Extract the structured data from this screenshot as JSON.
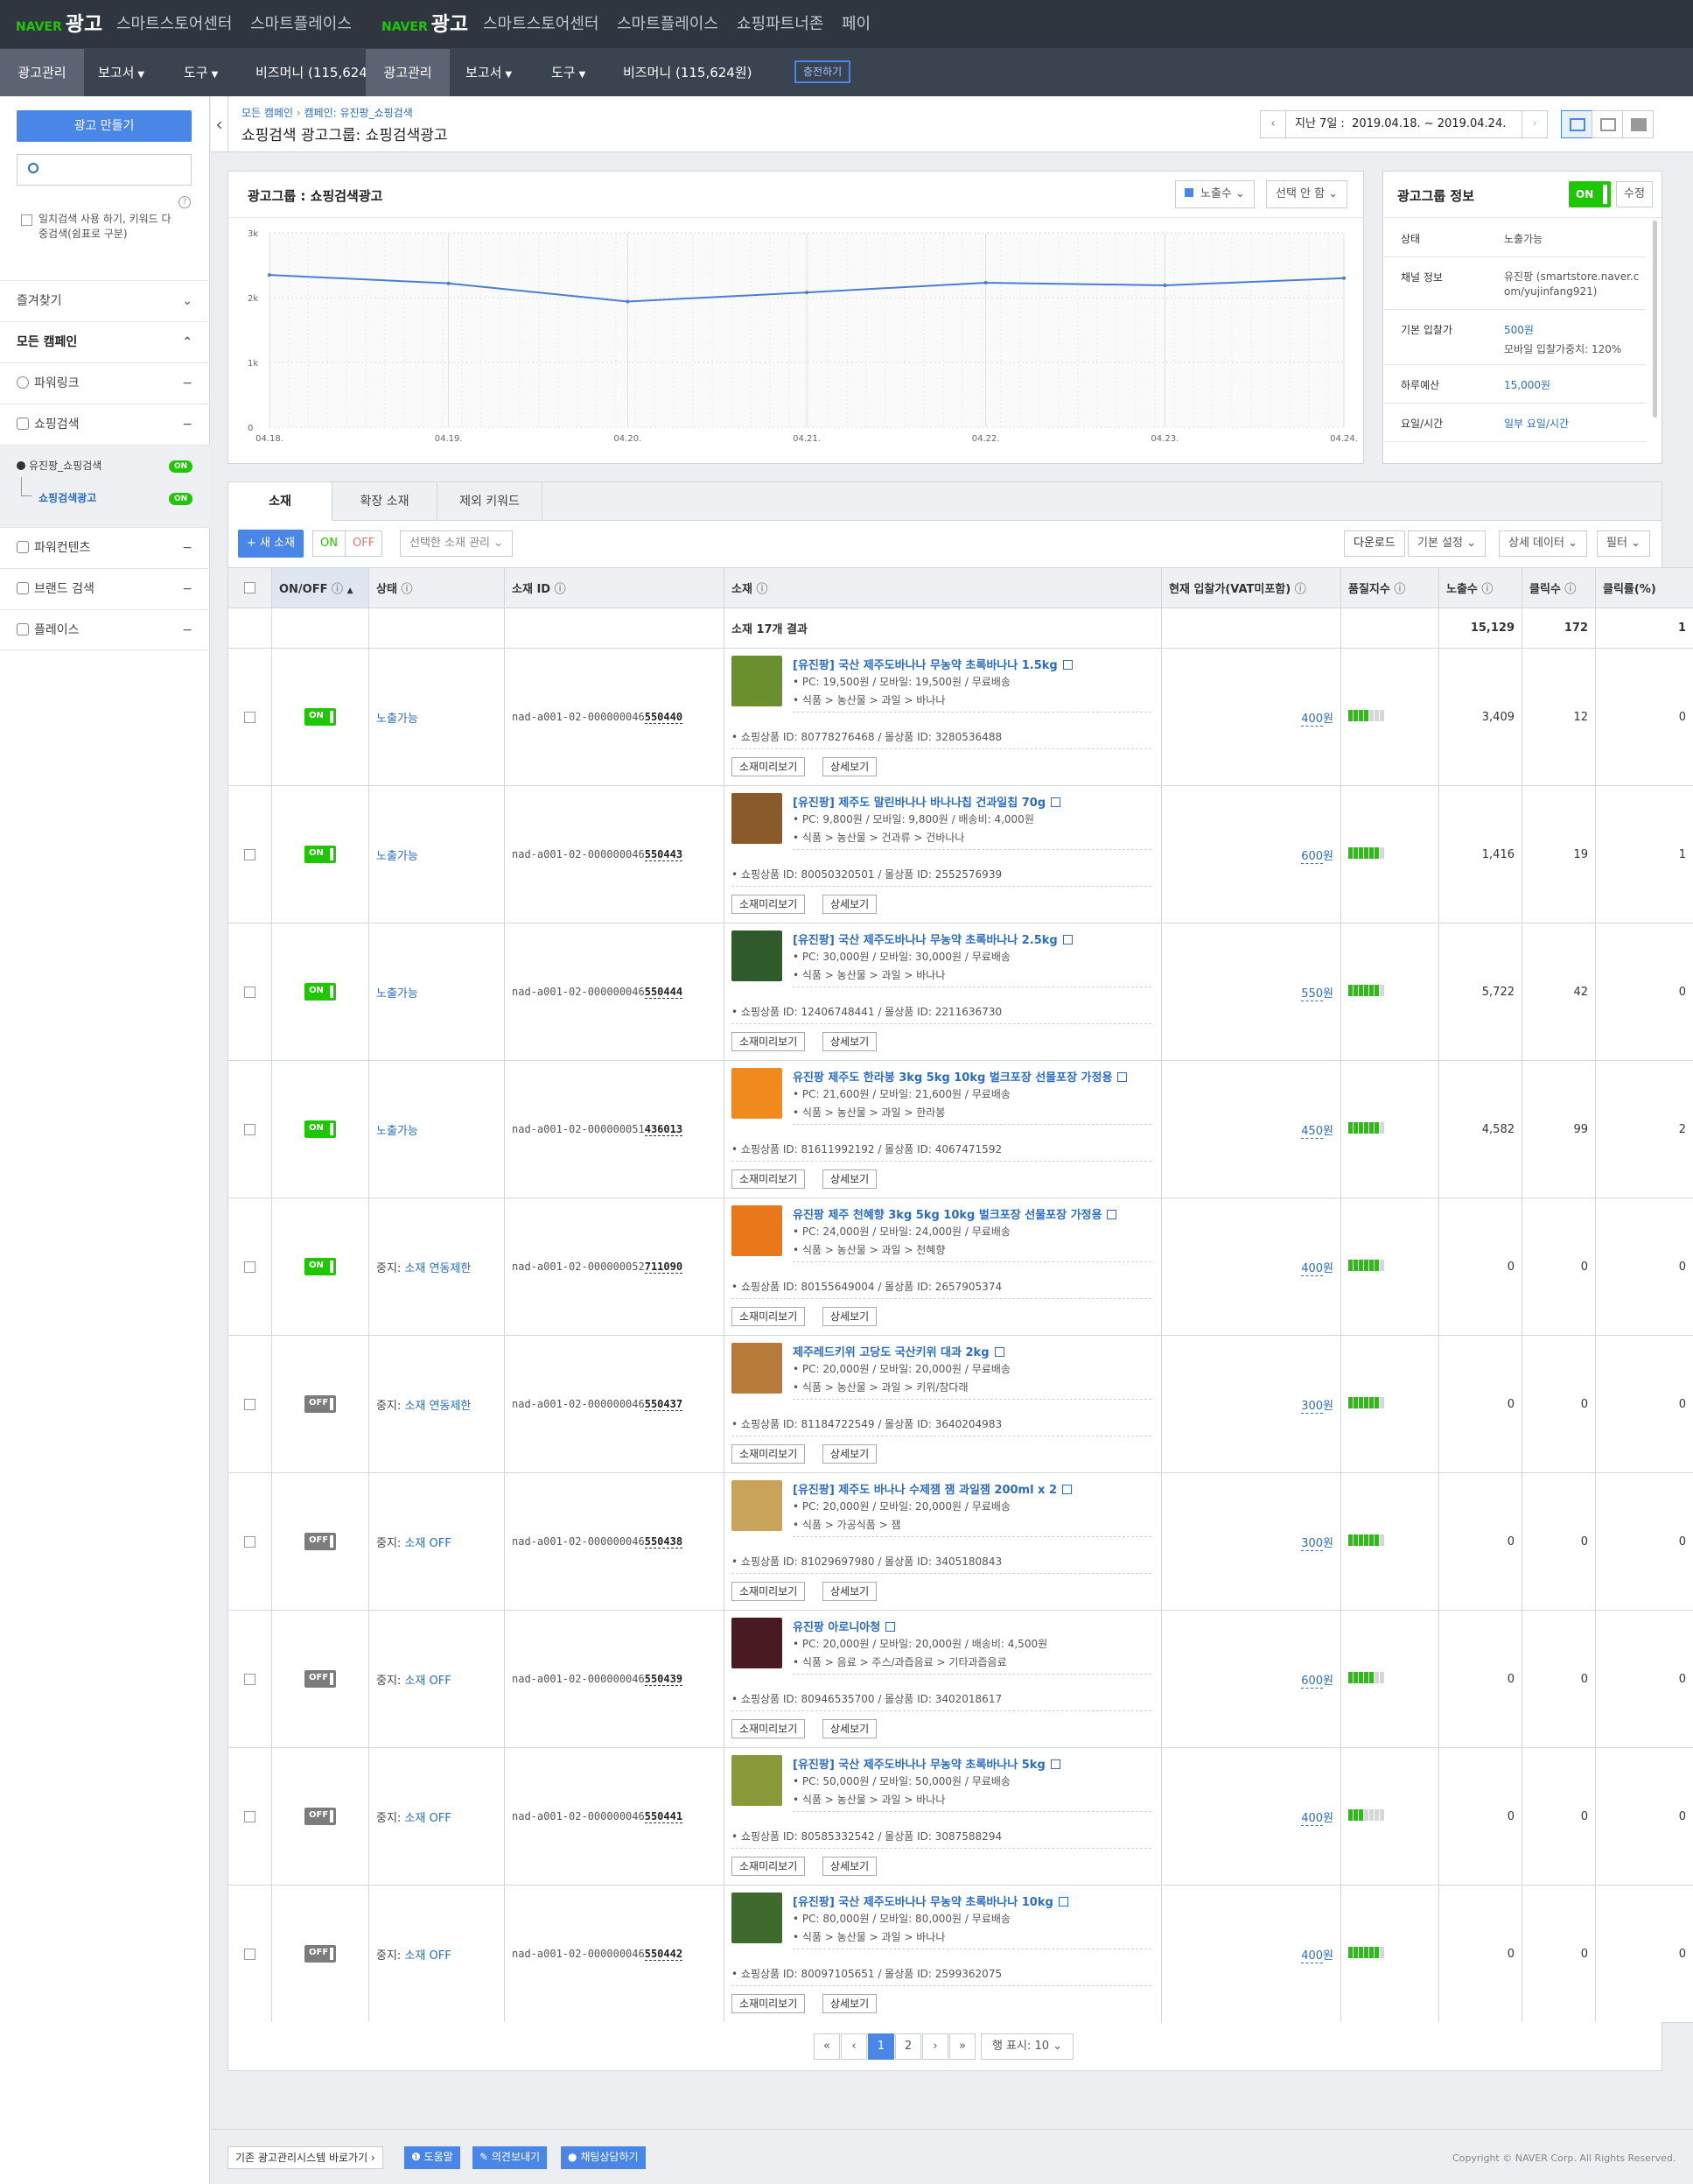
{
  "header": {
    "brand_left": "NAVER",
    "brand_right": "광고",
    "links1": [
      "스마트스토어센터",
      "스마트플레이스"
    ],
    "links2": [
      "스마트스토어센터",
      "스마트플레이스",
      "쇼핑파트너존",
      "페이"
    ]
  },
  "nav": {
    "items1": [
      "광고관리",
      "보고서",
      "도구",
      "비즈머니 (115,624"
    ],
    "items2": [
      "광고관리",
      "보고서",
      "도구",
      "비즈머니 (115,624원)"
    ],
    "charge": "충전하기"
  },
  "sidebar": {
    "create_btn": "광고 만들기",
    "exact_match": "일치검색 사용 하기, 키워드 다중검색(쉼표로 구분)",
    "favorites": "즐겨찾기",
    "all_campaigns": "모든 캠페인",
    "items": [
      "파워링크",
      "쇼핑검색",
      "파워컨텐츠",
      "브랜드 검색",
      "플레이스"
    ],
    "campaign": "유진팡_쇼핑검색",
    "adgroup": "쇼핑검색광고",
    "on": "ON"
  },
  "breadcrumb": {
    "path1": "모든 캠페인",
    "sep": "›",
    "path2": "캠페인: 유진팡_쇼핑검색",
    "title": "쇼핑검색 광고그룹: 쇼핑검색광고",
    "date_label": "지난 7일 :",
    "date_range": "2019.04.18. ~ 2019.04.24."
  },
  "chart_panel": {
    "title": "광고그룹 : 쇼핑검색광고",
    "metric": "노출수",
    "select": "선택 안 함"
  },
  "chart_data": {
    "type": "line",
    "categories": [
      "04.18.",
      "04.19.",
      "04.20.",
      "04.21.",
      "04.22.",
      "04.23.",
      "04.24."
    ],
    "series": [
      {
        "name": "노출수",
        "values": [
          2350,
          2220,
          1940,
          2080,
          2230,
          2190,
          2300
        ]
      }
    ],
    "yticks": [
      "0",
      "1k",
      "2k",
      "3k"
    ],
    "ylim": [
      0,
      3000
    ]
  },
  "info_panel": {
    "title": "광고그룹 정보",
    "toggle": "ON",
    "edit": "수정",
    "rows": [
      {
        "label": "상태",
        "value": "노출가능"
      },
      {
        "label": "채널 정보",
        "value": "유진팡 (smartstore.naver.com/yujinfang921)"
      },
      {
        "label": "기본 입찰가",
        "value": "500원",
        "extra": "모바일 입찰가중치: 120%"
      },
      {
        "label": "하루예산",
        "value": "15,000원"
      },
      {
        "label": "요일/시간",
        "value": "일부 요일/시간"
      }
    ]
  },
  "tabs": [
    "소재",
    "확장 소재",
    "제외 키워드"
  ],
  "toolbar": {
    "new": "+ 새 소재",
    "on": "ON",
    "off": "OFF",
    "manage": "선택한 소재 관리",
    "download": "다운로드",
    "basic": "기본 설정",
    "detail": "상세 데이터",
    "filter": "필터"
  },
  "table": {
    "headers": [
      "ON/OFF",
      "상태",
      "소재 ID",
      "소재",
      "현재 입찰가(VAT미포함)",
      "품질지수",
      "노출수",
      "클릭수",
      "클릭률(%)"
    ],
    "summary_label": "소재 17개 결과",
    "summary": {
      "impr": "15,129",
      "clicks": "172",
      "ctr": "1"
    },
    "btn_preview": "소재미리보기",
    "btn_detail": "상세보기",
    "rows": [
      {
        "toggle": "ON",
        "status": "노출가능",
        "status_pre": "",
        "id": "nad-a001-02-000000046",
        "id_tail": "550440",
        "title": "[유진팡] 국산 제주도바나나 무농약 초록바나나 1.5kg",
        "price": "PC: 19,500원 / 모바일: 19,500원 / 무료배송",
        "cat": "식품 > 농산물 > 과일 > 바나나",
        "ids": "쇼핑상품 ID: 80778276468 / 몰상품 ID: 3280536488",
        "bid": "400",
        "bidu": "원",
        "q": 4,
        "impr": "3,409",
        "clicks": "12",
        "ctr": "0",
        "img": "#6a8f2e"
      },
      {
        "toggle": "ON",
        "status": "노출가능",
        "status_pre": "",
        "id": "nad-a001-02-000000046",
        "id_tail": "550443",
        "title": "[유진팡] 제주도 말린바나나 바나나칩 건과일칩 70g",
        "price": "PC: 9,800원 / 모바일: 9,800원 / 배송비: 4,000원",
        "cat": "식품 > 농산물 > 건과류 > 건바나나",
        "ids": "쇼핑상품 ID: 80050320501 / 몰상품 ID: 2552576939",
        "bid": "600",
        "bidu": "원",
        "q": 6,
        "impr": "1,416",
        "clicks": "19",
        "ctr": "1",
        "img": "#8b5a2b"
      },
      {
        "toggle": "ON",
        "status": "노출가능",
        "status_pre": "",
        "id": "nad-a001-02-000000046",
        "id_tail": "550444",
        "title": "[유진팡] 국산 제주도바나나 무농약 초록바나나 2.5kg",
        "price": "PC: 30,000원 / 모바일: 30,000원 / 무료배송",
        "cat": "식품 > 농산물 > 과일 > 바나나",
        "ids": "쇼핑상품 ID: 12406748441 / 몰상품 ID: 2211636730",
        "bid": "550",
        "bidu": "원",
        "q": 6,
        "impr": "5,722",
        "clicks": "42",
        "ctr": "0",
        "img": "#2f5a2a"
      },
      {
        "toggle": "ON",
        "status": "노출가능",
        "status_pre": "",
        "id": "nad-a001-02-000000051",
        "id_tail": "436013",
        "title": "유진팡 제주도 한라봉 3kg 5kg 10kg 벌크포장 선물포장 가정용",
        "price": "PC: 21,600원 / 모바일: 21,600원 / 무료배송",
        "cat": "식품 > 농산물 > 과일 > 한라봉",
        "ids": "쇼핑상품 ID: 81611992192 / 몰상품 ID: 4067471592",
        "bid": "450",
        "bidu": "원",
        "q": 6,
        "impr": "4,582",
        "clicks": "99",
        "ctr": "2",
        "img": "#f08a1c"
      },
      {
        "toggle": "ON",
        "status": "소재 연동제한",
        "status_pre": "중지: ",
        "id": "nad-a001-02-000000052",
        "id_tail": "711090",
        "title": "유진팡 제주 천혜향 3kg 5kg 10kg 벌크포장 선물포장 가정용",
        "price": "PC: 24,000원 / 모바일: 24,000원 / 무료배송",
        "cat": "식품 > 농산물 > 과일 > 천혜향",
        "ids": "쇼핑상품 ID: 80155649004 / 몰상품 ID: 2657905374",
        "bid": "400",
        "bidu": "원",
        "q": 6,
        "impr": "0",
        "clicks": "0",
        "ctr": "0",
        "img": "#e8781a"
      },
      {
        "toggle": "OFF",
        "status": "소재 연동제한",
        "status_pre": "중지: ",
        "id": "nad-a001-02-000000046",
        "id_tail": "550437",
        "title": "제주레드키위 고당도 국산키위 대과 2kg",
        "price": "PC: 20,000원 / 모바일: 20,000원 / 무료배송",
        "cat": "식품 > 농산물 > 과일 > 키위/참다래",
        "ids": "쇼핑상품 ID: 81184722549 / 몰상품 ID: 3640204983",
        "bid": "300",
        "bidu": "원",
        "q": 6,
        "impr": "0",
        "clicks": "0",
        "ctr": "0",
        "img": "#b87a3a"
      },
      {
        "toggle": "OFF",
        "status": "소재 OFF",
        "status_pre": "중지: ",
        "id": "nad-a001-02-000000046",
        "id_tail": "550438",
        "title": "[유진팡] 제주도 바나나 수제잼 잼 과일잼 200ml x 2",
        "price": "PC: 20,000원 / 모바일: 20,000원 / 무료배송",
        "cat": "식품 > 가공식품 > 잼",
        "ids": "쇼핑상품 ID: 81029697980 / 몰상품 ID: 3405180843",
        "bid": "300",
        "bidu": "원",
        "q": 6,
        "impr": "0",
        "clicks": "0",
        "ctr": "0",
        "img": "#c9a35a"
      },
      {
        "toggle": "OFF",
        "status": "소재 OFF",
        "status_pre": "중지: ",
        "id": "nad-a001-02-000000046",
        "id_tail": "550439",
        "title": "유진팡 아로니아청",
        "price": "PC: 20,000원 / 모바일: 20,000원 / 배송비: 4,500원",
        "cat": "식품 > 음료 > 주스/과즙음료 > 기타과즙음료",
        "ids": "쇼핑상품 ID: 80946535700 / 몰상품 ID: 3402018617",
        "bid": "600",
        "bidu": "원",
        "q": 5,
        "impr": "0",
        "clicks": "0",
        "ctr": "0",
        "img": "#4a1a22"
      },
      {
        "toggle": "OFF",
        "status": "소재 OFF",
        "status_pre": "중지: ",
        "id": "nad-a001-02-000000046",
        "id_tail": "550441",
        "title": "[유진팡] 국산 제주도바나나 무농약 초록바나나 5kg",
        "price": "PC: 50,000원 / 모바일: 50,000원 / 무료배송",
        "cat": "식품 > 농산물 > 과일 > 바나나",
        "ids": "쇼핑상품 ID: 80585332542 / 몰상품 ID: 3087588294",
        "bid": "400",
        "bidu": "원",
        "q": 3,
        "impr": "0",
        "clicks": "0",
        "ctr": "0",
        "img": "#8a9a3a"
      },
      {
        "toggle": "OFF",
        "status": "소재 OFF",
        "status_pre": "중지: ",
        "id": "nad-a001-02-000000046",
        "id_tail": "550442",
        "title": "[유진팡] 국산 제주도바나나 무농약 초록바나나 10kg",
        "price": "PC: 80,000원 / 모바일: 80,000원 / 무료배송",
        "cat": "식품 > 농산물 > 과일 > 바나나",
        "ids": "쇼핑상품 ID: 80097105651 / 몰상품 ID: 2599362075",
        "bid": "400",
        "bidu": "원",
        "q": 6,
        "impr": "0",
        "clicks": "0",
        "ctr": "0",
        "img": "#3f6a2e"
      }
    ]
  },
  "pagination": {
    "first": "«",
    "prev": "‹",
    "pages": [
      "1",
      "2"
    ],
    "next": "›",
    "last": "»",
    "rows": "행 표시: 10"
  },
  "footer": {
    "old": "기존 광고관리시스템 바로가기",
    "help": "도움말",
    "feedback": "의견보내기",
    "chat": "채팅상담하기",
    "copyright": "Copyright © NAVER Corp. All Rights Reserved."
  }
}
